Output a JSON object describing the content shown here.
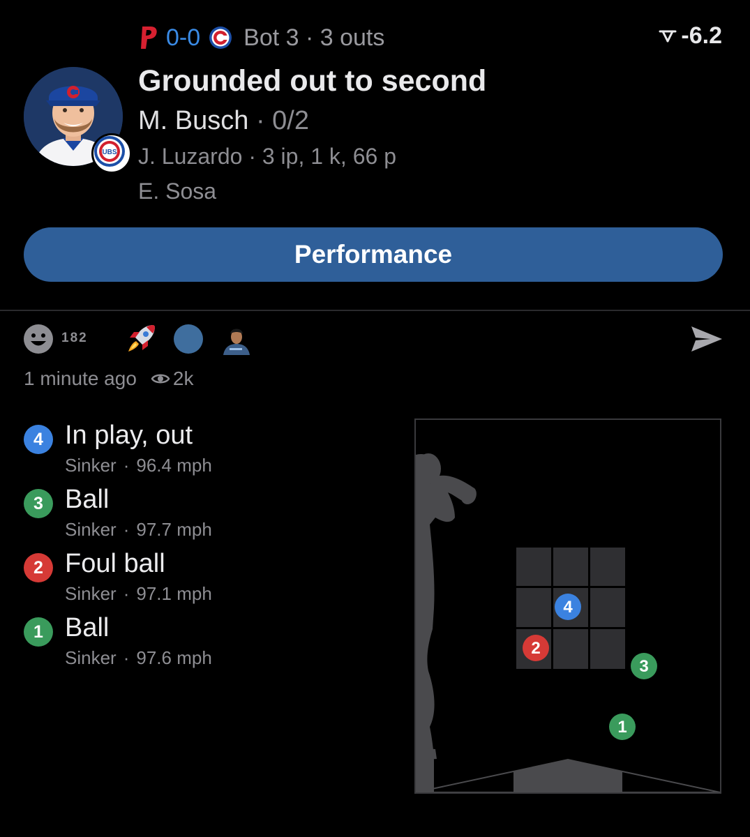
{
  "header": {
    "away_score": "0-0",
    "inning": "Bot 3 · 3 outs",
    "wpa": "-6.2"
  },
  "play": {
    "headline": "Grounded out to second",
    "batter_name": "M. Busch",
    "batter_sep": " · ",
    "batter_stat": "0/2",
    "pitcher_line": "J. Luzardo · 3 ip, 1 k, 66 p",
    "catcher_line": "E. Sosa",
    "team_badge_text": "UBS"
  },
  "performance_button": "Performance",
  "reactions": {
    "count": "182"
  },
  "meta": {
    "time_ago": "1 minute ago",
    "views": "2k"
  },
  "pitches": [
    {
      "num": "4",
      "result": "In play, out",
      "type": "Sinker",
      "speed": "96.4 mph",
      "color": "#3b82e0"
    },
    {
      "num": "3",
      "result": "Ball",
      "type": "Sinker",
      "speed": "97.7 mph",
      "color": "#3a9b5c"
    },
    {
      "num": "2",
      "result": "Foul ball",
      "type": "Sinker",
      "speed": "97.1 mph",
      "color": "#d63a36"
    },
    {
      "num": "1",
      "result": "Ball",
      "type": "Sinker",
      "speed": "97.6 mph",
      "color": "#3a9b5c"
    }
  ],
  "colors": {
    "accent_blue": "#3a8be6",
    "button_bg": "#2f5f99",
    "muted_text": "#8e8e93",
    "ball_green": "#3a9b5c",
    "foul_red": "#d63a36",
    "inplay_blue": "#3b82e0"
  },
  "icons": {
    "phillies": "phillies-p-logo",
    "cubs": "cubs-c-logo",
    "wpa": "wpa-arrow-icon",
    "reaction": "smiley-face-icon",
    "rocket": "rocket-emoji",
    "share": "send-arrow-icon",
    "views": "eye-icon"
  }
}
